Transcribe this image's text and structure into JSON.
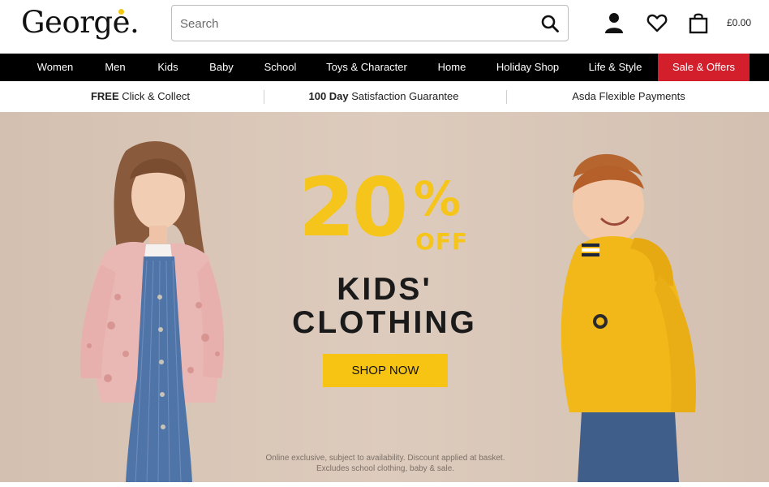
{
  "header": {
    "logo": "George",
    "logo_dot": ".",
    "search_placeholder": "Search",
    "basket_total": "£0.00",
    "icons": [
      "search-icon",
      "account-icon",
      "heart-icon",
      "basket-icon"
    ]
  },
  "nav": {
    "items": [
      "Women",
      "Men",
      "Kids",
      "Baby",
      "School",
      "Toys & Character",
      "Home",
      "Holiday Shop",
      "Life & Style",
      "Sale & Offers"
    ]
  },
  "usp": {
    "items": [
      {
        "bold": "FREE",
        "text": " Click & Collect"
      },
      {
        "bold": "100 Day",
        "text": " Satisfaction Guarantee"
      },
      {
        "bold": "",
        "text": "Asda Flexible Payments"
      }
    ]
  },
  "hero": {
    "percent": "20",
    "percent_sign": "%",
    "off": "OFF",
    "headline_line1": "KIDS'",
    "headline_line2": "CLOTHING",
    "cta": "SHOP NOW",
    "small_print_line1": "Online exclusive, subject to availability. Discount applied at basket.",
    "small_print_line2": "Excludes school clothing, baby & sale."
  },
  "colors": {
    "nav_bg": "#000000",
    "sale_bg": "#d21f2b",
    "accent_yellow": "#f6c51c",
    "hero_bg": "#d9c7b8"
  }
}
